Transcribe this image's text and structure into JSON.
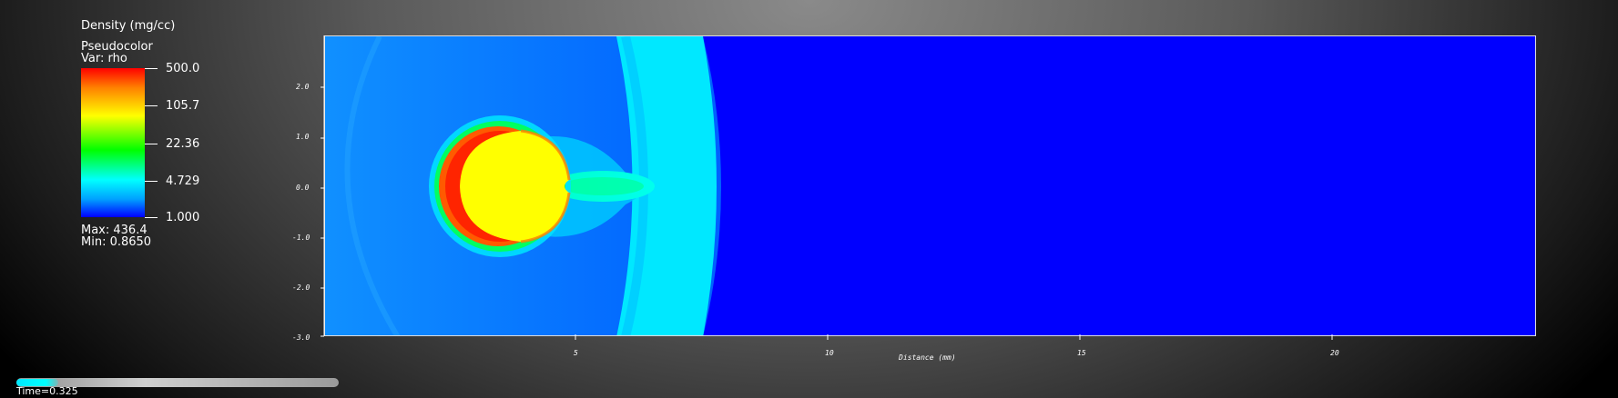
{
  "legend": {
    "title": "Density (mg/cc)",
    "plot_type": "Pseudocolor",
    "variable": "Var: rho",
    "ticks": [
      "500.0",
      "105.7",
      "22.36",
      "4.729",
      "1.000"
    ],
    "max_label": "Max:  436.4",
    "min_label": "Min:  0.8650"
  },
  "axes": {
    "xlabel": "Distance (mm)",
    "x_ticks": [
      "5",
      "10",
      "15",
      "20"
    ],
    "y_ticks": [
      "2.0",
      "1.0",
      "0.0",
      "-1.0",
      "-2.0",
      "-3.0"
    ]
  },
  "time": {
    "label": "Time=0.325",
    "fraction": 0.13
  },
  "colors": {
    "background_field": "#0000ff",
    "low": "#0000ff",
    "mid": "#00ff00",
    "high": "#ff0000"
  }
}
